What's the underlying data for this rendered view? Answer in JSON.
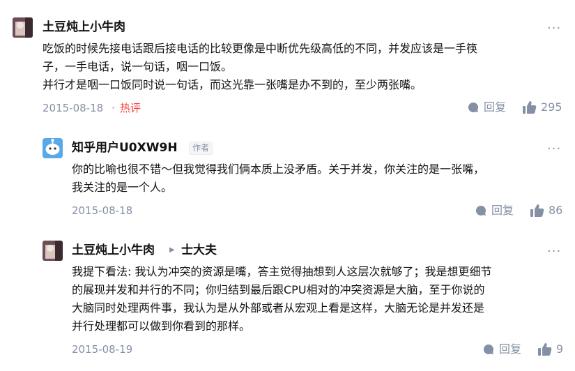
{
  "comments": [
    {
      "author": "土豆炖上小牛肉",
      "lines": [
        "吃饭的时候先接电话跟后接电话的比较更像是中断优先级高低的不同，并发应该是一手筷",
        "子，一手电话，说一句话，咽一口饭。",
        "并行才是咽一口饭同时说一句话，而这光靠一张嘴是办不到的，至少两张嘴。"
      ],
      "date": "2015-08-18",
      "separator": "·",
      "badge": "热评",
      "reply_label": "回复",
      "likes": "295",
      "more": "···"
    },
    {
      "author": "知乎用户U0XW9H",
      "author_tag": "作者",
      "lines": [
        "你的比喻也很不错～但我觉得我们俩本质上没矛盾。关于并发，你关注的是一张嘴，",
        "我关注的是一个人。"
      ],
      "date": "2015-08-18",
      "reply_label": "回复",
      "likes": "86",
      "more": "···"
    },
    {
      "author": "土豆炖上小牛肉",
      "reply_to": "士大夫",
      "lines": [
        "我提下看法: 我认为冲突的资源是嘴，答主觉得抽想到人这层次就够了；我是想更细节",
        "的展现并发和并行的不同；你归结到最后跟CPU相对的冲突资源是大脑，至于你说的",
        "大脑同时处理两件事，我认为是从外部或者从宏观上看是这样，大脑无论是并发还是",
        "并行处理都可以做到你看到的那样。"
      ],
      "date": "2015-08-19",
      "reply_label": "回复",
      "likes": "9",
      "more": "···"
    }
  ],
  "colors": {
    "text": "#121212",
    "meta": "#8590a6",
    "hot": "#f1403c",
    "avatar_bot": "#5aa9e6"
  },
  "icons": [
    "reply-bubble-icon",
    "thumbs-up-icon",
    "more-dots-icon",
    "reply-arrow-icon"
  ]
}
